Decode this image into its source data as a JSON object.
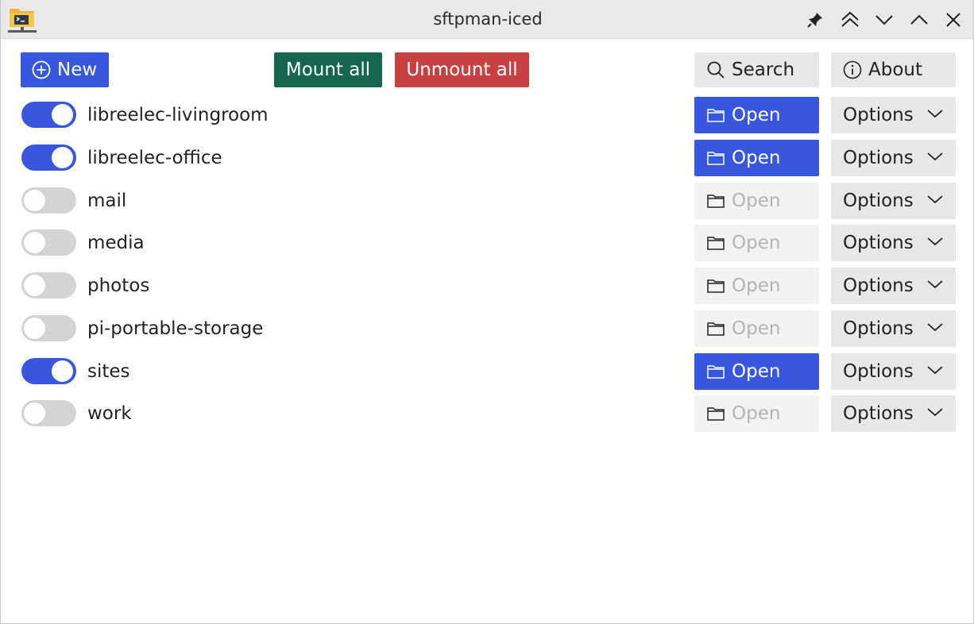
{
  "window": {
    "title": "sftpman-iced"
  },
  "toolbar": {
    "new_label": "New",
    "mount_all_label": "Mount all",
    "unmount_all_label": "Unmount all",
    "search_label": "Search",
    "about_label": "About"
  },
  "icons": {
    "app": "terminal-folder-icon",
    "pin": "pin-icon",
    "keep_above": "double-chevron-up-icon",
    "minimize": "chevron-down-icon",
    "maximize": "chevron-up-icon",
    "close": "close-icon",
    "new": "plus-circle-icon",
    "search": "search-icon",
    "about": "info-circle-icon",
    "open": "folder-icon",
    "options": "chevron-down-icon"
  },
  "colors": {
    "accent": "#3657de",
    "mount": "#14664d",
    "unmount": "#c94040"
  },
  "mounts": [
    {
      "name": "libreelec-livingroom",
      "mounted": true,
      "open_label": "Open",
      "options_label": "Options"
    },
    {
      "name": "libreelec-office",
      "mounted": true,
      "open_label": "Open",
      "options_label": "Options"
    },
    {
      "name": "mail",
      "mounted": false,
      "open_label": "Open",
      "options_label": "Options"
    },
    {
      "name": "media",
      "mounted": false,
      "open_label": "Open",
      "options_label": "Options"
    },
    {
      "name": "photos",
      "mounted": false,
      "open_label": "Open",
      "options_label": "Options"
    },
    {
      "name": "pi-portable-storage",
      "mounted": false,
      "open_label": "Open",
      "options_label": "Options"
    },
    {
      "name": "sites",
      "mounted": true,
      "open_label": "Open",
      "options_label": "Options"
    },
    {
      "name": "work",
      "mounted": false,
      "open_label": "Open",
      "options_label": "Options"
    }
  ]
}
